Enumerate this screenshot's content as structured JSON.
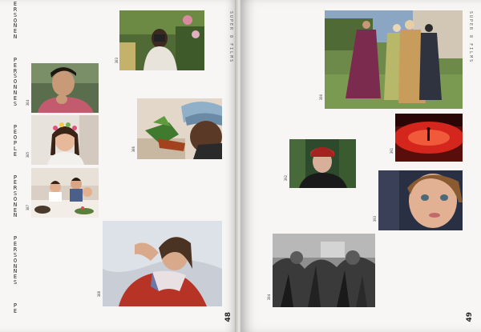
{
  "left_page": {
    "vertical_words": [
      "ERSONEN",
      "PERSONNES",
      "PEOPLE",
      "PERSONEN",
      "PERSONNES",
      "PE"
    ],
    "running_head": "SUPER 8 FILMS",
    "folio": "48",
    "captions": [
      "383",
      "384",
      "385",
      "386",
      "387",
      "388",
      "389"
    ]
  },
  "right_page": {
    "running_head": "SUPER 8 FILMS",
    "folio": "49",
    "captions": [
      "390",
      "391",
      "392",
      "393",
      "394"
    ]
  },
  "colors": {
    "paper": "#f7f6f4",
    "ink": "#222222"
  }
}
